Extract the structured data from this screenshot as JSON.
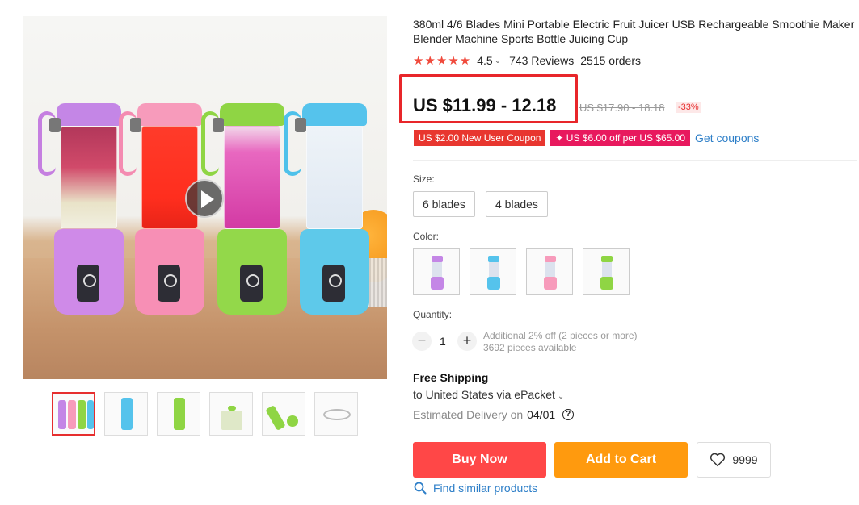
{
  "product": {
    "title": "380ml 4/6 Blades Mini Portable Electric Fruit Juicer USB Rechargeable Smoothie Maker Blender Machine Sports Bottle Juicing Cup",
    "rating_stars": "★★★★★",
    "rating": "4.5",
    "reviews": "743 Reviews",
    "orders": "2515 orders"
  },
  "price": {
    "current": "US $11.99 - 12.18",
    "original": "US $17.90 - 18.18",
    "discount": "-33%"
  },
  "coupons": {
    "new_user": "US $2.00 New User Coupon",
    "store": "✦ US $6.00 off per US $65.00",
    "get_label": "Get coupons"
  },
  "size": {
    "label": "Size:",
    "options": [
      "6 blades",
      "4 blades"
    ]
  },
  "color": {
    "label": "Color:",
    "options": [
      "purple",
      "blue",
      "pink",
      "green"
    ]
  },
  "quantity": {
    "label": "Quantity:",
    "minus": "−",
    "plus": "+",
    "value": "1",
    "note_1": "Additional 2% off (2 pieces or more)",
    "note_2": "3692 pieces available"
  },
  "shipping": {
    "title": "Free Shipping",
    "to": "to United States via ePacket",
    "delivery_label": "Estimated Delivery on",
    "delivery_date": "04/01",
    "help": "?"
  },
  "actions": {
    "buy_now": "Buy Now",
    "add_to_cart": "Add to Cart",
    "wishlist_count": "9999",
    "find_similar": "Find similar products"
  },
  "icons": {
    "chevron": "⌄"
  },
  "colors": {
    "accent_red": "#ff4747",
    "accent_orange": "#ff9a0e",
    "link_blue": "#2e7fc8",
    "star_red": "#f04a3c",
    "highlight_box": "#e8262a"
  }
}
